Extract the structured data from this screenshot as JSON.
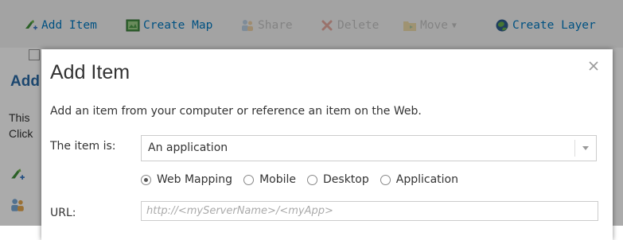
{
  "toolbar": {
    "add_item": "Add Item",
    "create_map": "Create Map",
    "share": "Share",
    "delete": "Delete",
    "move": "Move",
    "create_layer": "Create Layer"
  },
  "background": {
    "heading": "Add",
    "line1": "This",
    "line2": "Click"
  },
  "dialog": {
    "title": "Add Item",
    "description": "Add an item from your computer or reference an item on the Web.",
    "item_is_label": "The item is:",
    "item_type_value": "An application",
    "radio_options": [
      "Web Mapping",
      "Mobile",
      "Desktop",
      "Application"
    ],
    "selected_radio": "Web Mapping",
    "url_label": "URL:",
    "url_placeholder": "http://<myServerName>/<myApp>"
  },
  "colors": {
    "toolbar_link": "#007ac2",
    "toolbar_disabled": "#c4c4c4",
    "heading_blue": "#2a6aa6",
    "overlay": "rgba(0,0,0,0.33)"
  },
  "icons": [
    "add-item-icon",
    "map-icon",
    "share-icon",
    "delete-icon",
    "move-icon",
    "create-layer-icon",
    "close-icon",
    "chevron-down-icon"
  ]
}
